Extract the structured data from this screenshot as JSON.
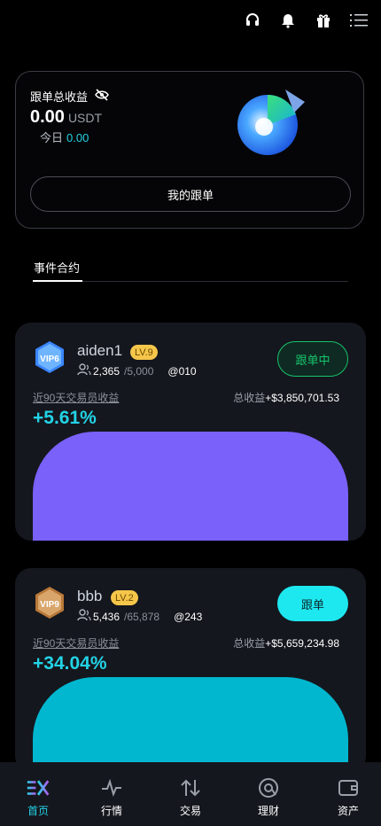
{
  "topbar": {
    "icons": [
      "headset-icon",
      "bell-icon",
      "gift-icon",
      "menu-icon"
    ]
  },
  "summary": {
    "title": "跟单总收益",
    "amount": "0.00",
    "unit": "USDT",
    "today_label": "今日",
    "today_value": "0.00",
    "my_follow_label": "我的跟单"
  },
  "tabs": {
    "event_contract": "事件合约"
  },
  "traders": [
    {
      "name": "aiden1",
      "level": "LV.9",
      "followers": "2,365",
      "max_followers": "/5,000",
      "handle": "@010",
      "follow_label": "跟单中",
      "return_label": "近90天交易员收益",
      "return_value": "+5.61%",
      "total_label": "总收益",
      "total_value": "+$3,850,701.53",
      "vip_text": "VIP6",
      "chart_color": "#7a61fa"
    },
    {
      "name": "bbb",
      "level": "LV.2",
      "followers": "5,436",
      "max_followers": "/65,878",
      "handle": "@243",
      "follow_label": "跟单",
      "return_label": "近90天交易员收益",
      "return_value": "+34.04%",
      "total_label": "总收益",
      "total_value": "+$5,659,234.98",
      "vip_text": "VIP9",
      "chart_color": "#00b7cf"
    }
  ],
  "bottomnav": {
    "items": [
      {
        "label": "首页",
        "icon": "home-logo-icon",
        "active": true
      },
      {
        "label": "行情",
        "icon": "market-pulse-icon",
        "active": false
      },
      {
        "label": "交易",
        "icon": "trade-arrows-icon",
        "active": false
      },
      {
        "label": "理财",
        "icon": "finance-icon",
        "active": false
      },
      {
        "label": "资产",
        "icon": "wallet-icon",
        "active": false
      }
    ]
  },
  "colors": {
    "accent": "#22d3e6",
    "following_green": "#16c46c",
    "follow_button": "#1de8f0",
    "level_badge": "#f5c64a"
  }
}
